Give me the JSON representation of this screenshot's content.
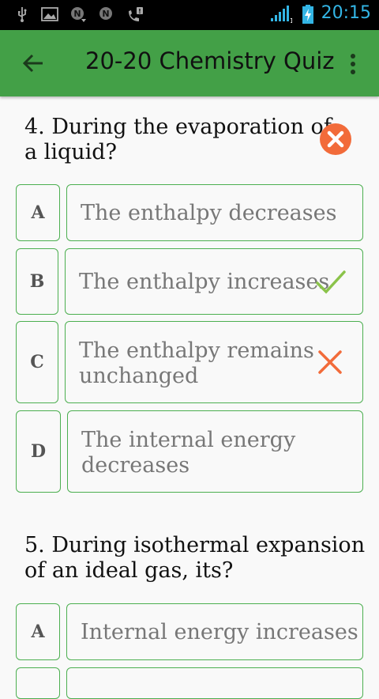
{
  "status_bar": {
    "time": "20:15",
    "icons": [
      "usb-icon",
      "image-icon",
      "notification-n-icon",
      "notification-n-icon",
      "missed-call-icon",
      "signal-icon",
      "battery-charging-icon"
    ]
  },
  "app_bar": {
    "title": "20-20 Chemistry Quiz",
    "back_icon": "arrow-left-icon",
    "menu_icon": "more-vertical-icon"
  },
  "colors": {
    "primary": "#43a047",
    "border": "#4caf50",
    "correct": "#8bc34a",
    "wrong": "#f26b3a"
  },
  "questions": [
    {
      "text_lines": [
        "4. During the evaporation of",
        "a liquid?"
      ],
      "result_icon": "wrong-answer-icon",
      "options": [
        {
          "letter": "A",
          "lines": [
            "The enthalpy decreases"
          ],
          "mark": null
        },
        {
          "letter": "B",
          "lines": [
            "The enthalpy increases"
          ],
          "mark": "check-icon"
        },
        {
          "letter": "C",
          "lines": [
            "The enthalpy remains",
            "unchanged"
          ],
          "mark": "cross-icon"
        },
        {
          "letter": "D",
          "lines": [
            "The internal energy",
            "decreases"
          ],
          "mark": null
        }
      ]
    },
    {
      "text_lines": [
        "5. During isothermal expansion",
        "of an ideal gas, its?"
      ],
      "options": [
        {
          "letter": "A",
          "lines": [
            "Internal energy increases"
          ],
          "mark": null
        }
      ]
    }
  ]
}
